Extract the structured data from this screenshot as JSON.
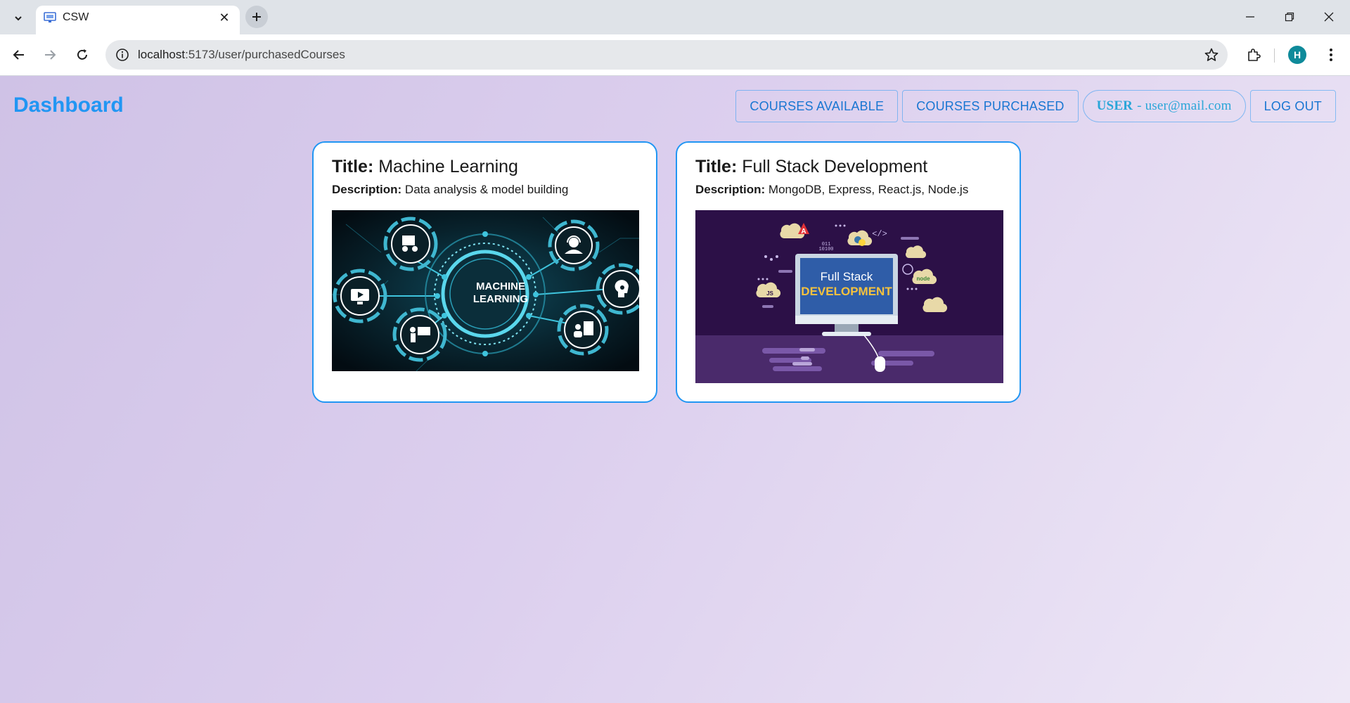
{
  "browser": {
    "tab_title": "CSW",
    "url_host": "localhost",
    "url_path": ":5173/user/purchasedCourses",
    "profile_initial": "H"
  },
  "header": {
    "brand": "Dashboard",
    "nav": {
      "courses_available": "COURSES AVAILABLE",
      "courses_purchased": "COURSES PURCHASED",
      "user_label": "USER",
      "user_email": "- user@mail.com",
      "logout": "LOG OUT"
    }
  },
  "courses": [
    {
      "title_label": "Title:",
      "title": "Machine Learning",
      "desc_label": "Description:",
      "description": "Data analysis & model building",
      "image_text_1": "MACHINE",
      "image_text_2": "LEARNING"
    },
    {
      "title_label": "Title:",
      "title": "Full Stack Development",
      "desc_label": "Description:",
      "description": "MongoDB, Express, React.js, Node.js",
      "image_text_1": "Full Stack",
      "image_text_2": "DEVELOPMENT",
      "image_badge_code": "</>",
      "image_badge_binary_1": "011",
      "image_badge_binary_2": "10100",
      "image_badge_node": "node",
      "image_badge_js": "JS",
      "image_badge_angular": "A"
    }
  ],
  "colors": {
    "accent": "#2196f3",
    "card_border": "#2196f3",
    "page_gradient_start": "#cfc2e6",
    "page_gradient_end": "#eee8f6"
  }
}
